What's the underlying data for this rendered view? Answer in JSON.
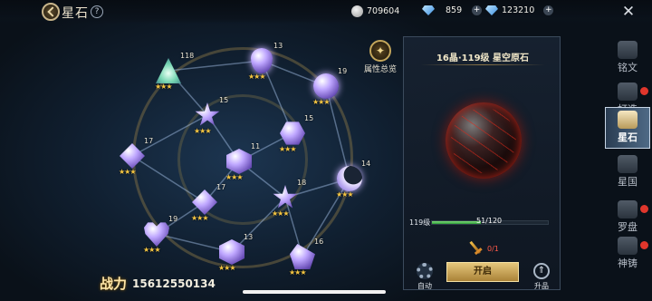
{
  "header": {
    "title": "星石",
    "help": "?",
    "currency1": "709604",
    "currency2": "859",
    "currency3": "123210",
    "close": "✕"
  },
  "constellation": {
    "nodes": [
      {
        "id": "n1",
        "level": "118",
        "stars": "★★★"
      },
      {
        "id": "n2",
        "level": "13",
        "stars": "★★★"
      },
      {
        "id": "n3",
        "level": "19",
        "stars": "★★★"
      },
      {
        "id": "n4",
        "level": "15",
        "stars": "★★★"
      },
      {
        "id": "n5",
        "level": "15",
        "stars": "★★★"
      },
      {
        "id": "n6",
        "level": "17",
        "stars": "★★★"
      },
      {
        "id": "n7",
        "level": "11",
        "stars": "★★★"
      },
      {
        "id": "n8",
        "level": "14",
        "stars": "★★★"
      },
      {
        "id": "n9",
        "level": "17",
        "stars": "★★★"
      },
      {
        "id": "n10",
        "level": "18",
        "stars": "★★★"
      },
      {
        "id": "n11",
        "level": "19",
        "stars": "★★★"
      },
      {
        "id": "n12",
        "level": "13",
        "stars": "★★★"
      },
      {
        "id": "n13",
        "level": "16",
        "stars": "★★★"
      }
    ],
    "attributes_label": "属性总览",
    "power_label": "战力",
    "power_value": "15612550134"
  },
  "detail": {
    "title": "16晶·119级 星空原石",
    "level_label": "119级",
    "progress_text": "51/120",
    "progress": 0.425,
    "item_count": "0/1",
    "auto_label": "自动",
    "open_label": "开启",
    "upgrade_label": "升品"
  },
  "tabs": [
    {
      "label": "铭文",
      "active": false,
      "dot": false
    },
    {
      "label": "打造",
      "active": false,
      "dot": true
    },
    {
      "label": "星石",
      "active": true,
      "dot": false
    },
    {
      "label": "星国",
      "active": false,
      "dot": false
    },
    {
      "label": "罗盘",
      "active": false,
      "dot": true
    },
    {
      "label": "神铸",
      "active": false,
      "dot": true
    }
  ]
}
